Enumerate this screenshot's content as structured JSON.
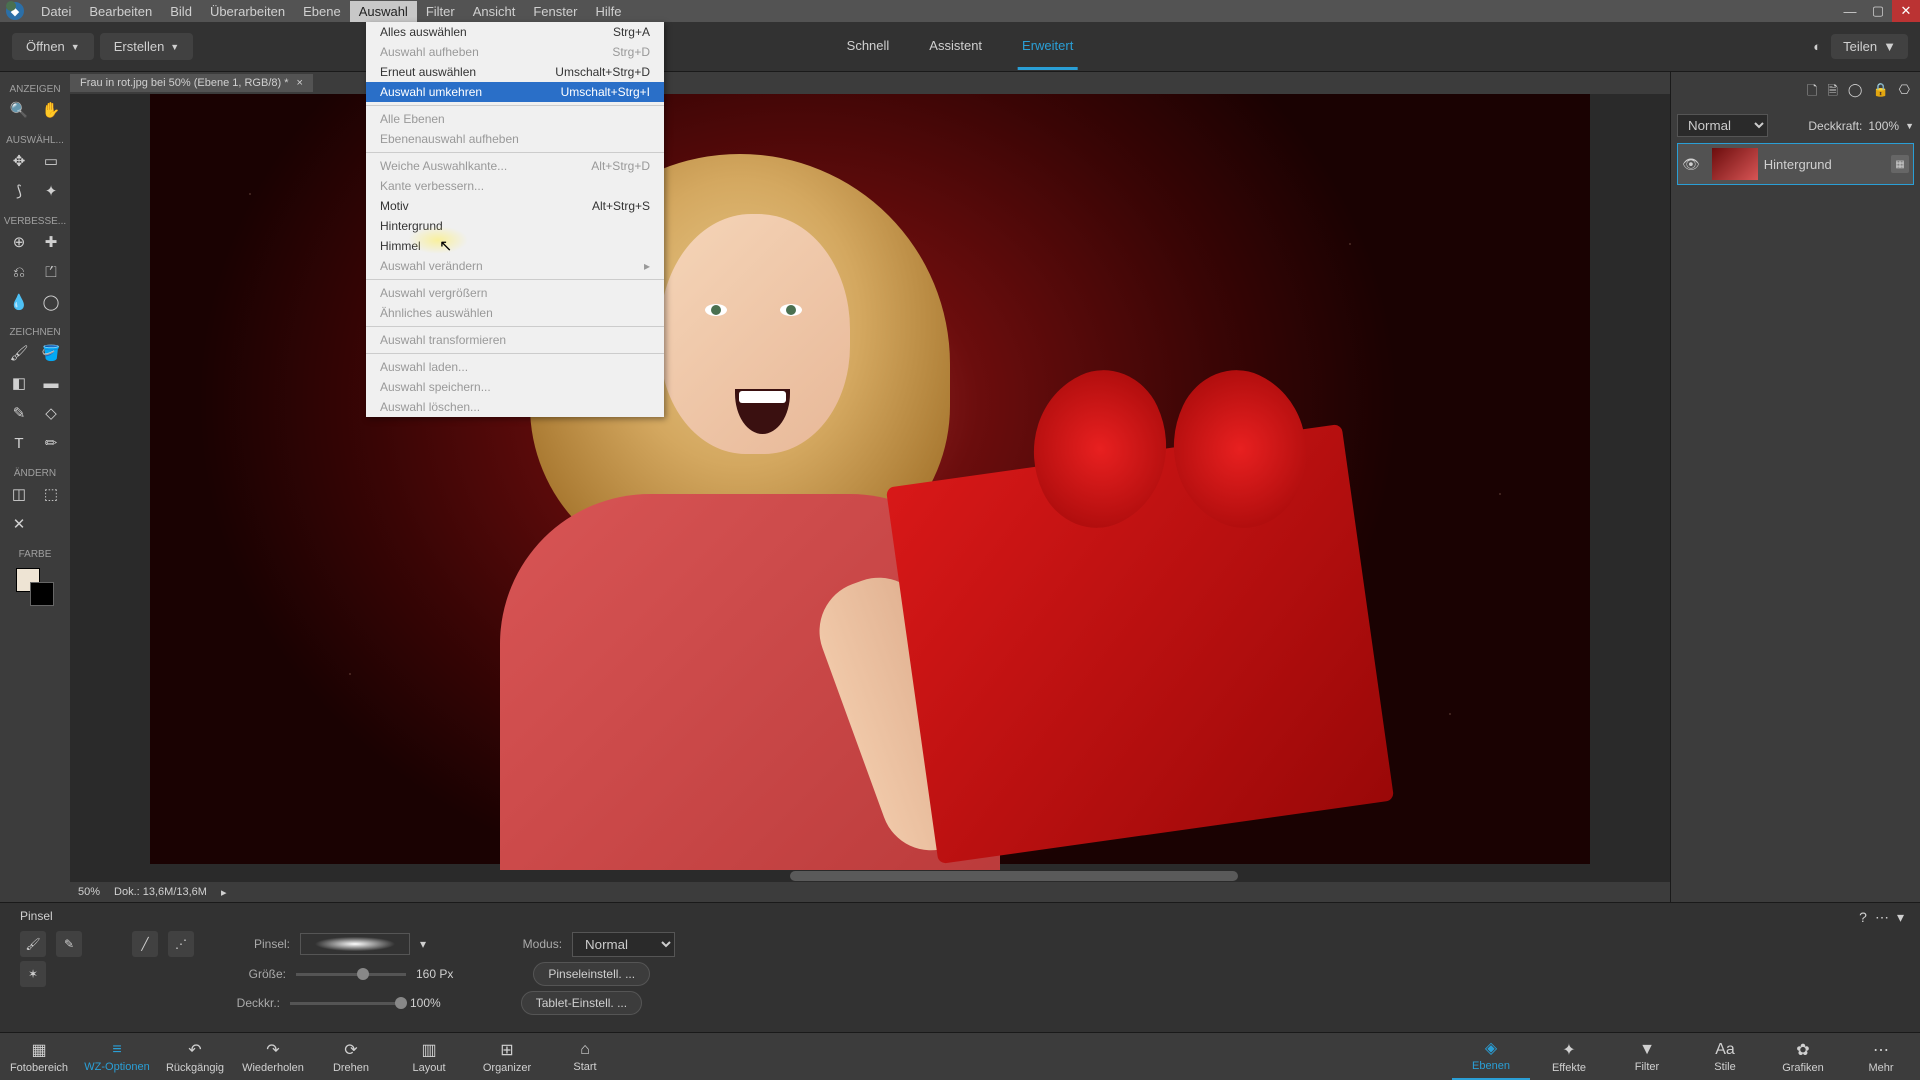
{
  "menu": {
    "items": [
      "Datei",
      "Bearbeiten",
      "Bild",
      "Überarbeiten",
      "Ebene",
      "Auswahl",
      "Filter",
      "Ansicht",
      "Fenster",
      "Hilfe"
    ],
    "active": 5
  },
  "toolbar": {
    "open": "Öffnen",
    "create": "Erstellen",
    "tabs": [
      "Schnell",
      "Assistent",
      "Erweitert"
    ],
    "share": "Teilen"
  },
  "doc": {
    "title": "Frau in rot.jpg bei 50% (Ebene 1, RGB/8) *",
    "zoom": "50%",
    "docsize": "Dok.: 13,6M/13,6M"
  },
  "left": {
    "cat0": "ANZEIGEN",
    "cat1": "AUSWÄHL...",
    "cat2": "VERBESSE...",
    "cat3": "ZEICHNEN",
    "cat4": "ÄNDERN",
    "cat5": "FARBE"
  },
  "dropdown": [
    {
      "label": "Alles auswählen",
      "sc": "Strg+A"
    },
    {
      "label": "Auswahl aufheben",
      "sc": "Strg+D",
      "disabled": true
    },
    {
      "label": "Erneut auswählen",
      "sc": "Umschalt+Strg+D"
    },
    {
      "label": "Auswahl umkehren",
      "sc": "Umschalt+Strg+I",
      "highlight": true,
      "disabled": true
    },
    {
      "sep": true
    },
    {
      "label": "Alle Ebenen",
      "sc": "",
      "disabled": true
    },
    {
      "label": "Ebenenauswahl aufheben",
      "sc": "",
      "disabled": true
    },
    {
      "sep": true
    },
    {
      "label": "Weiche Auswahlkante...",
      "sc": "Alt+Strg+D",
      "disabled": true
    },
    {
      "label": "Kante verbessern...",
      "sc": "",
      "disabled": true
    },
    {
      "label": "Motiv",
      "sc": "Alt+Strg+S"
    },
    {
      "label": "Hintergrund",
      "sc": ""
    },
    {
      "label": "Himmel",
      "sc": ""
    },
    {
      "label": "Auswahl verändern",
      "sc": "",
      "sub": true,
      "disabled": true
    },
    {
      "sep": true
    },
    {
      "label": "Auswahl vergrößern",
      "sc": "",
      "disabled": true
    },
    {
      "label": "Ähnliches auswählen",
      "sc": "",
      "disabled": true
    },
    {
      "sep": true
    },
    {
      "label": "Auswahl transformieren",
      "sc": "",
      "disabled": true
    },
    {
      "sep": true
    },
    {
      "label": "Auswahl laden...",
      "sc": "",
      "disabled": true
    },
    {
      "label": "Auswahl speichern...",
      "sc": "",
      "disabled": true
    },
    {
      "label": "Auswahl löschen...",
      "sc": "",
      "disabled": true
    }
  ],
  "layers": {
    "blend": "Normal",
    "opacityLabel": "Deckkraft:",
    "opacity": "100%",
    "name": "Hintergrund"
  },
  "opt": {
    "title": "Pinsel",
    "brushLabel": "Pinsel:",
    "modeLabel": "Modus:",
    "mode": "Normal",
    "sizeLabel": "Größe:",
    "size": "160 Px",
    "opLabel": "Deckkr.:",
    "op": "100%",
    "b1": "Pinseleinstell. ...",
    "b2": "Tablet-Einstell. ..."
  },
  "bottom": {
    "left": [
      "Fotobereich",
      "WZ-Optionen",
      "Rückgängig",
      "Wiederholen",
      "Drehen",
      "Layout",
      "Organizer",
      "Start"
    ],
    "right": [
      "Ebenen",
      "Effekte",
      "Filter",
      "Stile",
      "Grafiken",
      "Mehr"
    ]
  }
}
